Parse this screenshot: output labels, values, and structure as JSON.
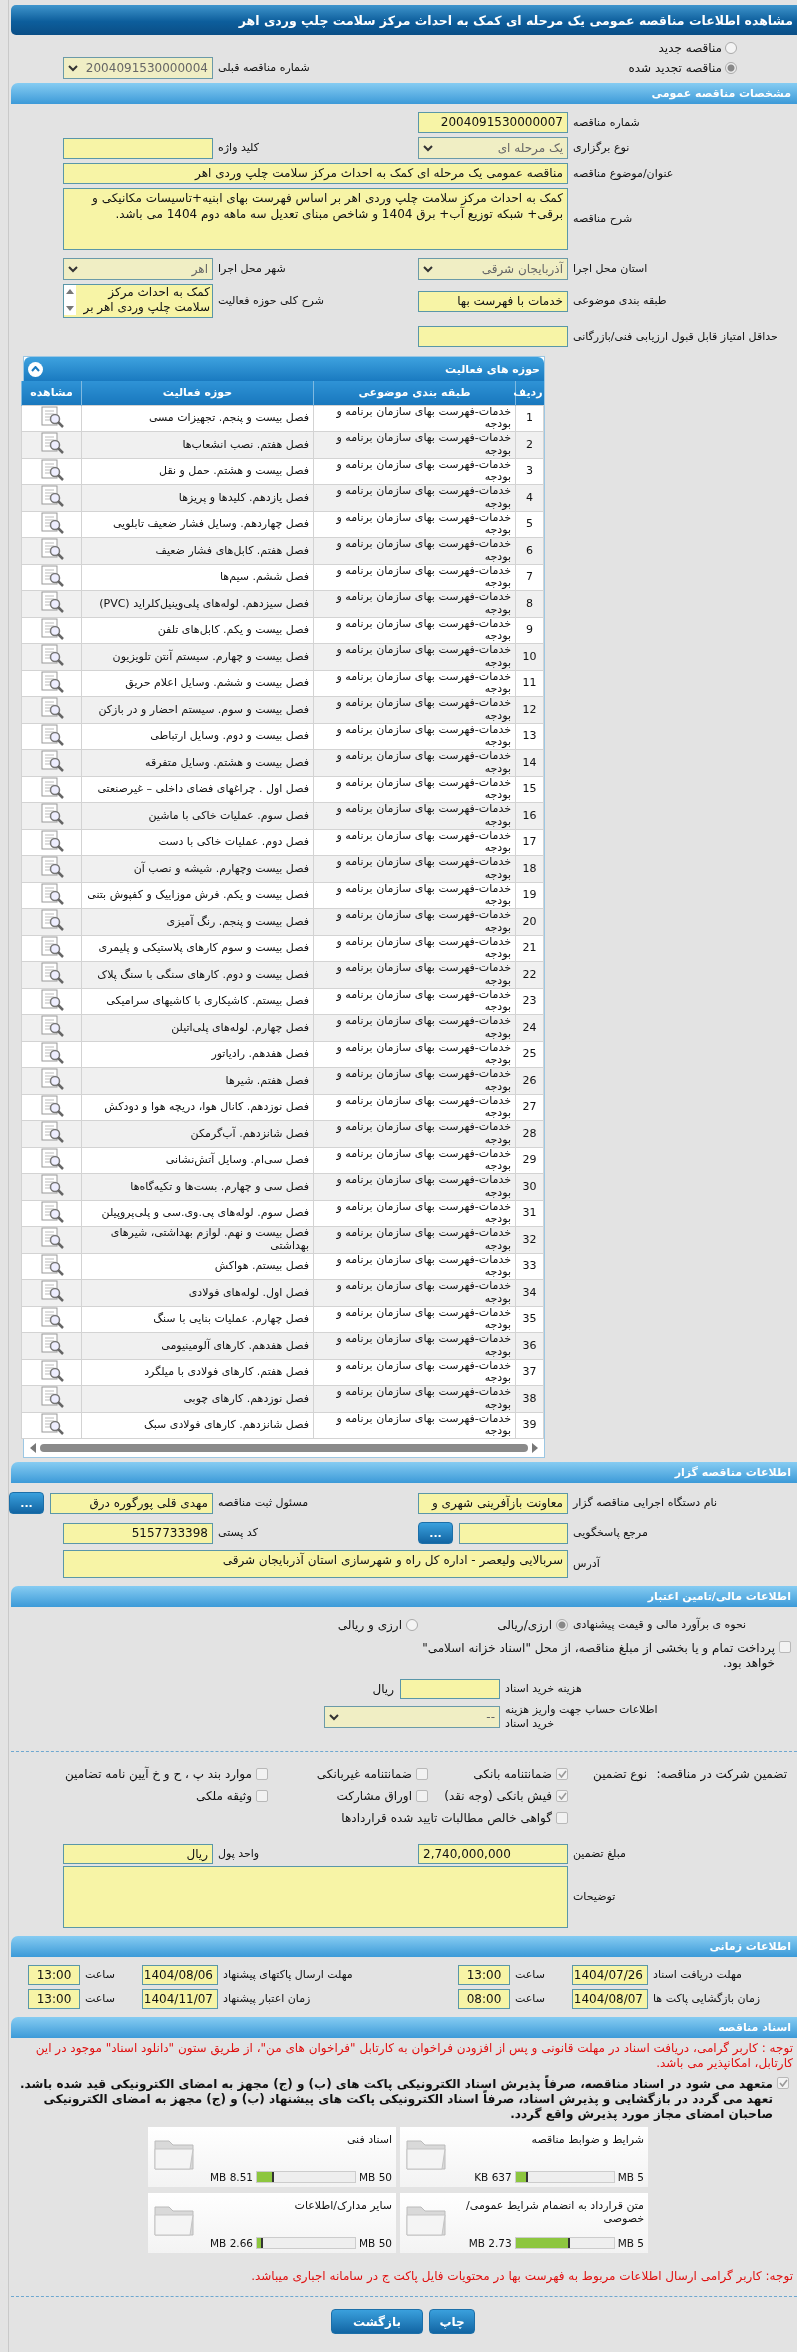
{
  "title": "مشاهده اطلاعات مناقصه عمومی یک مرحله ای کمک به احداث مرکز سلامت چلپ وردی اهر",
  "tender_status": [
    {
      "label": "مناقصه جدید",
      "selected": false
    },
    {
      "label": "مناقصه تجدید شده",
      "selected": true
    }
  ],
  "previous_tender": {
    "label": "شماره مناقصه قبلی",
    "value": "2004091530000004"
  },
  "general": {
    "title": "مشخصات مناقصه عمومی",
    "rows": [
      [
        {
          "label": "شماره مناقصه",
          "kind": "text",
          "value": "2004091530000007"
        }
      ],
      [
        {
          "label": "نوع برگزاری",
          "kind": "select",
          "value": "یک مرحله ای"
        },
        {
          "label": "کلید واژه",
          "kind": "text"
        }
      ],
      [
        {
          "label": "عنوان/موضوع مناقصه",
          "kind": "wide_text",
          "value": "مناقصه عمومی یک مرحله ای کمک به احداث مرکز سلامت چلپ وردی اهر"
        }
      ],
      [
        {
          "label": "شرح مناقصه",
          "kind": "textarea",
          "value": "کمک به احداث مرکز سلامت چلپ وردی اهر بر اساس فهرست بهای ابنیه+تاسیسات مکانیکی و برقی+ شبکه توزیع آب+ برق 1404 و شاخص مبنای تعدیل سه ماهه دوم 1404 می باشد."
        }
      ],
      [
        {
          "label": "استان محل اجرا",
          "kind": "select",
          "value": "آذربایجان شرقی"
        },
        {
          "label": "شهر محل اجرا",
          "kind": "select",
          "value": "اهر"
        }
      ],
      [
        {
          "label": "طبقه بندی موضوعی",
          "kind": "text",
          "value": "خدمات با فهرست بها"
        },
        {
          "label": "شرح کلی حوزه فعالیت",
          "kind": "listbox",
          "value": "کمک به احداث مرکز سلامت چلپ وردی اهر بر"
        }
      ],
      [
        {
          "label": "حداقل امتیاز قابل قبول ارزیابی فنی/بازرگانی",
          "kind": "text"
        }
      ]
    ]
  },
  "activities": {
    "title": "حوزه های فعالیت",
    "columns": [
      "ردیف",
      "طبقه بندی موضوعی",
      "حوزه فعالیت",
      "مشاهده"
    ],
    "rows": [
      {
        "index": "1",
        "category": "خدمات-فهرست بهای سازمان برنامه و بودجه",
        "activity": "فصل بیست و پنجم. تجهیزات مسی"
      },
      {
        "index": "2",
        "category": "خدمات-فهرست بهای سازمان برنامه و بودجه",
        "activity": "فصل هفتم. نصب انشعاب‌ها"
      },
      {
        "index": "3",
        "category": "خدمات-فهرست بهای سازمان برنامه و بودجه",
        "activity": "فصل بیست و هشتم. حمل و نقل"
      },
      {
        "index": "4",
        "category": "خدمات-فهرست بهای سازمان برنامه و بودجه",
        "activity": "فصل یازدهم. کلیدها و پریزها"
      },
      {
        "index": "5",
        "category": "خدمات-فهرست بهای سازمان برنامه و بودجه",
        "activity": "فصل چهاردهم. وسایل فشار ضعیف تابلویی"
      },
      {
        "index": "6",
        "category": "خدمات-فهرست بهای سازمان برنامه و بودجه",
        "activity": "فصل هفتم. کابل‌های فشار ضعیف"
      },
      {
        "index": "7",
        "category": "خدمات-فهرست بهای سازمان برنامه و بودجه",
        "activity": "فصل ششم. سیم‌ها"
      },
      {
        "index": "8",
        "category": "خدمات-فهرست بهای سازمان برنامه و بودجه",
        "activity": "فصل سیزدهم. لوله‌های پلی‌وینیل‌کلراید (PVC)"
      },
      {
        "index": "9",
        "category": "خدمات-فهرست بهای سازمان برنامه و بودجه",
        "activity": "فصل بیست و یکم. کابل‌های تلفن"
      },
      {
        "index": "10",
        "category": "خدمات-فهرست بهای سازمان برنامه و بودجه",
        "activity": "فصل بیست و چهارم. سیستم آنتن تلویزیون"
      },
      {
        "index": "11",
        "category": "خدمات-فهرست بهای سازمان برنامه و بودجه",
        "activity": "فصل بیست و ششم. وسایل اعلام حریق"
      },
      {
        "index": "12",
        "category": "خدمات-فهرست بهای سازمان برنامه و بودجه",
        "activity": "فصل بیست و سوم. سیستم احضار و در بازکن"
      },
      {
        "index": "13",
        "category": "خدمات-فهرست بهای سازمان برنامه و بودجه",
        "activity": "فصل بیست و دوم. وسایل ارتباطی"
      },
      {
        "index": "14",
        "category": "خدمات-فهرست بهای سازمان برنامه و بودجه",
        "activity": "فصل بیست و هشتم. وسایل متفرقه"
      },
      {
        "index": "15",
        "category": "خدمات-فهرست بهای سازمان برنامه و بودجه",
        "activity": "فصل اول . چراغهای فضای داخلی – غیرصنعتی"
      },
      {
        "index": "16",
        "category": "خدمات-فهرست بهای سازمان برنامه و بودجه",
        "activity": "فصل سوم. عملیات خاکی با ماشین"
      },
      {
        "index": "17",
        "category": "خدمات-فهرست بهای سازمان برنامه و بودجه",
        "activity": "فصل دوم. عملیات خاکی با دست"
      },
      {
        "index": "18",
        "category": "خدمات-فهرست بهای سازمان برنامه و بودجه",
        "activity": "فصل بیست وچهارم. شیشه و نصب آن"
      },
      {
        "index": "19",
        "category": "خدمات-فهرست بهای سازمان برنامه و بودجه",
        "activity": "فصل بیست و یکم. فرش موزاییک و کفپوش بتنی"
      },
      {
        "index": "20",
        "category": "خدمات-فهرست بهای سازمان برنامه و بودجه",
        "activity": "فصل بیست و پنجم. رنگ آمیزی"
      },
      {
        "index": "21",
        "category": "خدمات-فهرست بهای سازمان برنامه و بودجه",
        "activity": "فصل بیست و سوم کارهای پلاستیکی و پلیمری"
      },
      {
        "index": "22",
        "category": "خدمات-فهرست بهای سازمان برنامه و بودجه",
        "activity": "فصل بیست و دوم. کارهای سنگی با سنگ پلاک"
      },
      {
        "index": "23",
        "category": "خدمات-فهرست بهای سازمان برنامه و بودجه",
        "activity": "فصل بیستم. کاشیکاری با کاشیهای سرامیکی"
      },
      {
        "index": "24",
        "category": "خدمات-فهرست بهای سازمان برنامه و بودجه",
        "activity": "فصل چهارم. لوله‌های پلی‌اتیلن"
      },
      {
        "index": "25",
        "category": "خدمات-فهرست بهای سازمان برنامه و بودجه",
        "activity": "فصل هفدهم. رادیاتور"
      },
      {
        "index": "26",
        "category": "خدمات-فهرست بهای سازمان برنامه و بودجه",
        "activity": "فصل هفتم. شیرها"
      },
      {
        "index": "27",
        "category": "خدمات-فهرست بهای سازمان برنامه و بودجه",
        "activity": "فصل نوزدهم. کانال هوا، دریچه هوا و دودکش"
      },
      {
        "index": "28",
        "category": "خدمات-فهرست بهای سازمان برنامه و بودجه",
        "activity": "فصل شانزدهم. آب‌گرمکن"
      },
      {
        "index": "29",
        "category": "خدمات-فهرست بهای سازمان برنامه و بودجه",
        "activity": "فصل سی‌ام. وسایل آتش‌نشانی"
      },
      {
        "index": "30",
        "category": "خدمات-فهرست بهای سازمان برنامه و بودجه",
        "activity": "فصل سی و چهارم. بست‌ها و تکیه‌گاه‌ها"
      },
      {
        "index": "31",
        "category": "خدمات-فهرست بهای سازمان برنامه و بودجه",
        "activity": "فصل سوم. لوله‌های پی.وی.سی و پلی‌پروپیلن"
      },
      {
        "index": "32",
        "category": "خدمات-فهرست بهای سازمان برنامه و بودجه",
        "activity": "فصل بیست و نهم. لوازم بهداشتی، شیرهای بهداشتی"
      },
      {
        "index": "33",
        "category": "خدمات-فهرست بهای سازمان برنامه و بودجه",
        "activity": "فصل بیستم. هواکش"
      },
      {
        "index": "34",
        "category": "خدمات-فهرست بهای سازمان برنامه و بودجه",
        "activity": "فصل اول. لوله‌های فولادی"
      },
      {
        "index": "35",
        "category": "خدمات-فهرست بهای سازمان برنامه و بودجه",
        "activity": "فصل چهارم. عملیات بنایی با سنگ"
      },
      {
        "index": "36",
        "category": "خدمات-فهرست بهای سازمان برنامه و بودجه",
        "activity": "فصل هفدهم. کارهای آلومینیومی"
      },
      {
        "index": "37",
        "category": "خدمات-فهرست بهای سازمان برنامه و بودجه",
        "activity": "فصل هفتم. کارهای فولادی با میلگرد"
      },
      {
        "index": "38",
        "category": "خدمات-فهرست بهای سازمان برنامه و بودجه",
        "activity": "فصل نوزدهم. کارهای چوبی"
      },
      {
        "index": "39",
        "category": "خدمات-فهرست بهای سازمان برنامه و بودجه",
        "activity": "فصل شانزدهم. کارهای فولادی سبک"
      }
    ]
  },
  "tenderer": {
    "title": "اطلاعات مناقصه گزار",
    "rows": [
      [
        {
          "label": "نام دستگاه اجرایی مناقصه گزار",
          "kind": "text",
          "value": "معاونت بازآفرینی شهری و"
        },
        {
          "label": "مسئول ثبت مناقصه",
          "kind": "text",
          "value": "مهدی قلی پورگوره درق",
          "button": "..."
        }
      ],
      [
        {
          "label": "مرجع پاسخگویی",
          "kind": "text",
          "button": "..."
        },
        {
          "label": "کد پستی",
          "kind": "text",
          "value": "5157733398"
        }
      ],
      [
        {
          "label": "آدرس",
          "kind": "wide_text",
          "value": "سربالایی ولیعصر - اداره کل راه و شهرسازی استان آذربایجان شرقی"
        }
      ]
    ]
  },
  "finance": {
    "title": "اطلاعات مالی/تامین اعتبار",
    "estimate": {
      "label": "نحوه ی برآورد مالی و قیمت پیشنهادی",
      "options": [
        {
          "label": "ارزی/ریالی",
          "selected": true
        },
        {
          "label": "ارزی و ریالی",
          "selected": false
        }
      ]
    },
    "treasury": {
      "label": "پرداخت تمام و یا بخشی از مبلغ مناقصه، از محل \"اسناد خزانه اسلامی\" خواهد بود.",
      "checked": false
    },
    "document_cost": {
      "label": "هزینه خرید اسناد",
      "unit": "ریال"
    },
    "account": {
      "label": "اطلاعات حساب جهت واریز هزینه خرید اسناد",
      "value": "--"
    }
  },
  "guarantee": {
    "label": "تضمین شرکت در مناقصه:",
    "type_label": "نوع تضمین",
    "options": [
      {
        "label": "ضمانتنامه بانکی",
        "checked": true
      },
      {
        "label": "ضمانتنامه غیربانکی",
        "checked": false
      },
      {
        "label": "موارد بند پ ، ح و خ آیین نامه تضامین",
        "checked": false
      },
      {
        "label": "فیش بانکی (وجه نقد)",
        "checked": true
      },
      {
        "label": "اوراق مشارکت",
        "checked": false
      },
      {
        "label": "وثیقه ملکی",
        "checked": false
      },
      {
        "label": "گواهی خالص مطالبات تایید شده قراردادها",
        "checked": false
      }
    ],
    "amount": {
      "label": "مبلغ تضمین",
      "value": "2,740,000,000"
    },
    "currency": {
      "label": "واحد پول",
      "value": "ریال"
    },
    "notes": {
      "label": "توضیحات"
    }
  },
  "schedule": {
    "title": "اطلاعات زمانی",
    "items": [
      {
        "label": "مهلت دریافت اسناد",
        "date": "1404/07/26",
        "time_label": "ساعت",
        "time": "13:00"
      },
      {
        "label": "مهلت ارسال پاکتهای پیشنهاد",
        "date": "1404/08/06",
        "time_label": "ساعت",
        "time": "13:00"
      },
      {
        "label": "زمان بازگشایی پاکت ها",
        "date": "1404/08/07",
        "time_label": "ساعت",
        "time": "08:00"
      },
      {
        "label": "زمان اعتبار پیشنهاد",
        "date": "1404/11/07",
        "time_label": "ساعت",
        "time": "13:00"
      }
    ]
  },
  "documents": {
    "title": "اسناد مناقصه",
    "note": "توجه : کاربر گرامی، دریافت اسناد در مهلت قانونی و پس از افزودن فراخوان به کارتابل \"فراخوان های من\"، از طریق ستون \"دانلود اسناد\" موجود در این کارتابل، امکانپذیر می باشد.",
    "commitment": {
      "text": "متعهد می شود در اسناد مناقصه، صرفاً پذیرش اسناد الکترونیکی پاکت های (ب) و (ج) مجهز به امضای الکترونیکی قید شده باشد. تعهد می گردد در بازگشایی و پذیرش اسناد، صرفاً اسناد الکترونیکی پاکت های پیشنهاد (ب) و (ج) مجهز به امضای الکترونیکی صاحبان امضای مجاز مورد پذیرش واقع گردد.",
      "checked": true
    },
    "files": [
      {
        "title": "شرایط و ضوابط مناقصه",
        "limit": "5 MB",
        "size": "637 KB",
        "level": 0.13
      },
      {
        "title": "اسناد فنی",
        "limit": "50 MB",
        "size": "8.51 MB",
        "level": 0.17
      },
      {
        "title": "متن قرارداد به انضمام شرایط عمومی/خصوصی",
        "limit": "5 MB",
        "size": "2.73 MB",
        "level": 0.55
      },
      {
        "title": "سایر مدارک/اطلاعات",
        "limit": "50 MB",
        "size": "2.66 MB",
        "level": 0.06
      }
    ],
    "footer_note": "توجه: کاربر گرامی ارسال اطلاعات مربوط به فهرست بها در محتویات فایل پاکت ج در سامانه اجباری میباشد."
  },
  "buttons": [
    "چاپ",
    "بازگشت"
  ]
}
